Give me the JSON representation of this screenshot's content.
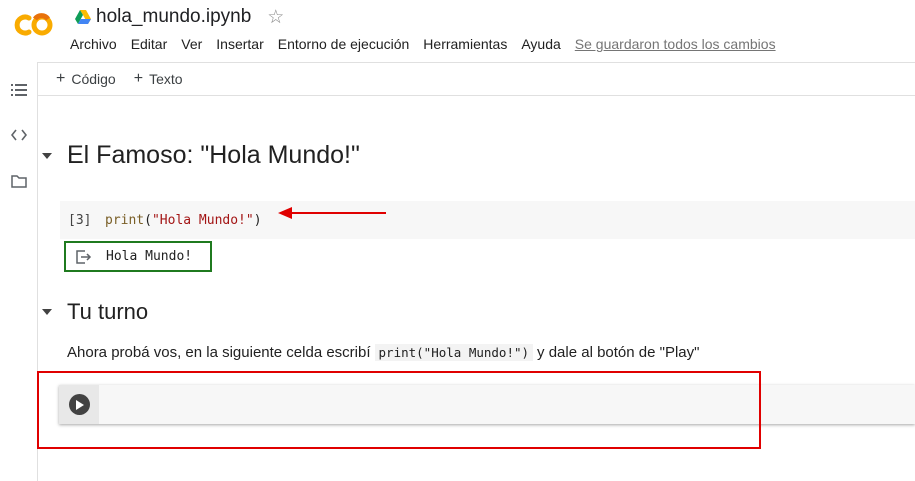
{
  "header": {
    "logo_icon": "colab-logo-icon",
    "drive_icon": "google-drive-icon",
    "title": "hola_mundo.ipynb",
    "star_icon": "star-icon",
    "star_glyph": "☆"
  },
  "menu": {
    "items": [
      "Archivo",
      "Editar",
      "Ver",
      "Insertar",
      "Entorno de ejecución",
      "Herramientas",
      "Ayuda"
    ],
    "saved_status": "Se guardaron todos los cambios"
  },
  "sidebar": {
    "icons": [
      "table-of-contents-icon",
      "code-snippets-icon",
      "files-folder-icon"
    ]
  },
  "toolbar": {
    "add_code": "Código",
    "add_text": "Texto",
    "plus_glyph": "+"
  },
  "notebook": {
    "section1_title": "El Famoso: \"Hola Mundo!\"",
    "code_cell": {
      "exec_count": "[3]",
      "fn": "print",
      "open_paren": "(",
      "string": "\"Hola Mundo!\"",
      "close_paren": ")"
    },
    "output_text": "Hola Mundo!",
    "section2_title": "Tu turno",
    "instruction": {
      "before": "Ahora probá vos, en la siguiente celda escribí",
      "code": "print(\"Hola Mundo!\")",
      "after": "y dale al botón de \"Play\""
    }
  },
  "colors": {
    "annotation_red": "#e00000",
    "output_border_green": "#1f7a1f",
    "string_red": "#a31515",
    "function_brown": "#795e26",
    "colab_orange": "#f9ab00"
  }
}
